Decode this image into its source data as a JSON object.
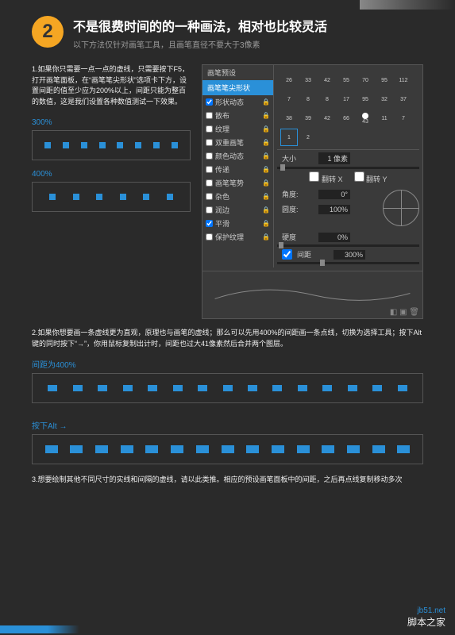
{
  "header": {
    "step_number": "2",
    "title": "不是很费时间的的一种画法，相对也比较灵活",
    "subtitle": "以下方法仅针对画笔工具，且画笔直径不要大于3像素"
  },
  "instruction1": "1.如果你只需要一点一点的虚线，只需要按下F5，打开画笔面板，在“画笔笔尖形状”选项卡下方，设置间距的值至少应为200%以上，间距只能为整百的数值，这是我们设置各种数值测试一下效果。",
  "samples": {
    "s1": "300%",
    "s2": "400%",
    "s3": "间距为400%",
    "s4": "按下Alt →"
  },
  "brush_panel": {
    "tab1": "画笔预设",
    "tab2": "画笔笔尖形状",
    "options": [
      "形状动态",
      "散布",
      "纹理",
      "双重画笔",
      "颜色动态",
      "传递",
      "画笔笔势",
      "杂色",
      "润边",
      "平滑",
      "保护纹理"
    ],
    "brush_sizes": [
      "26",
      "33",
      "42",
      "55",
      "70",
      "95",
      "112",
      "7",
      "8",
      "8",
      "17",
      "95",
      "32",
      "37",
      "38",
      "39",
      "42",
      "66",
      "43",
      "11",
      "7",
      "1",
      "2"
    ],
    "size_label": "大小",
    "size_value": "1 像素",
    "flipx": "翻转 X",
    "flipy": "翻转 Y",
    "angle_label": "角度:",
    "angle_value": "0°",
    "roundness_label": "圆度:",
    "roundness_value": "100%",
    "hardness_label": "硬度",
    "hardness_value": "0%",
    "spacing_label": "间距",
    "spacing_value": "300%"
  },
  "instruction2": "2.如果你想要画一条虚线更为直观，原理也与画笔的虚线；那么可以先用400%的间距画一条点线，切换为选择工具；按下Alt键的同时按下“→”，你用鼠标复制出计时，间距也过大41像素然后合并两个图层。",
  "instruction3": "3.想要绘制其他不同尺寸的实线和间隔的虚线，请以此类推。相应的预设画笔面板中的间距，之后再点线复制移动多次",
  "watermark": {
    "site": "jb51.net",
    "name": "脚本之家"
  }
}
